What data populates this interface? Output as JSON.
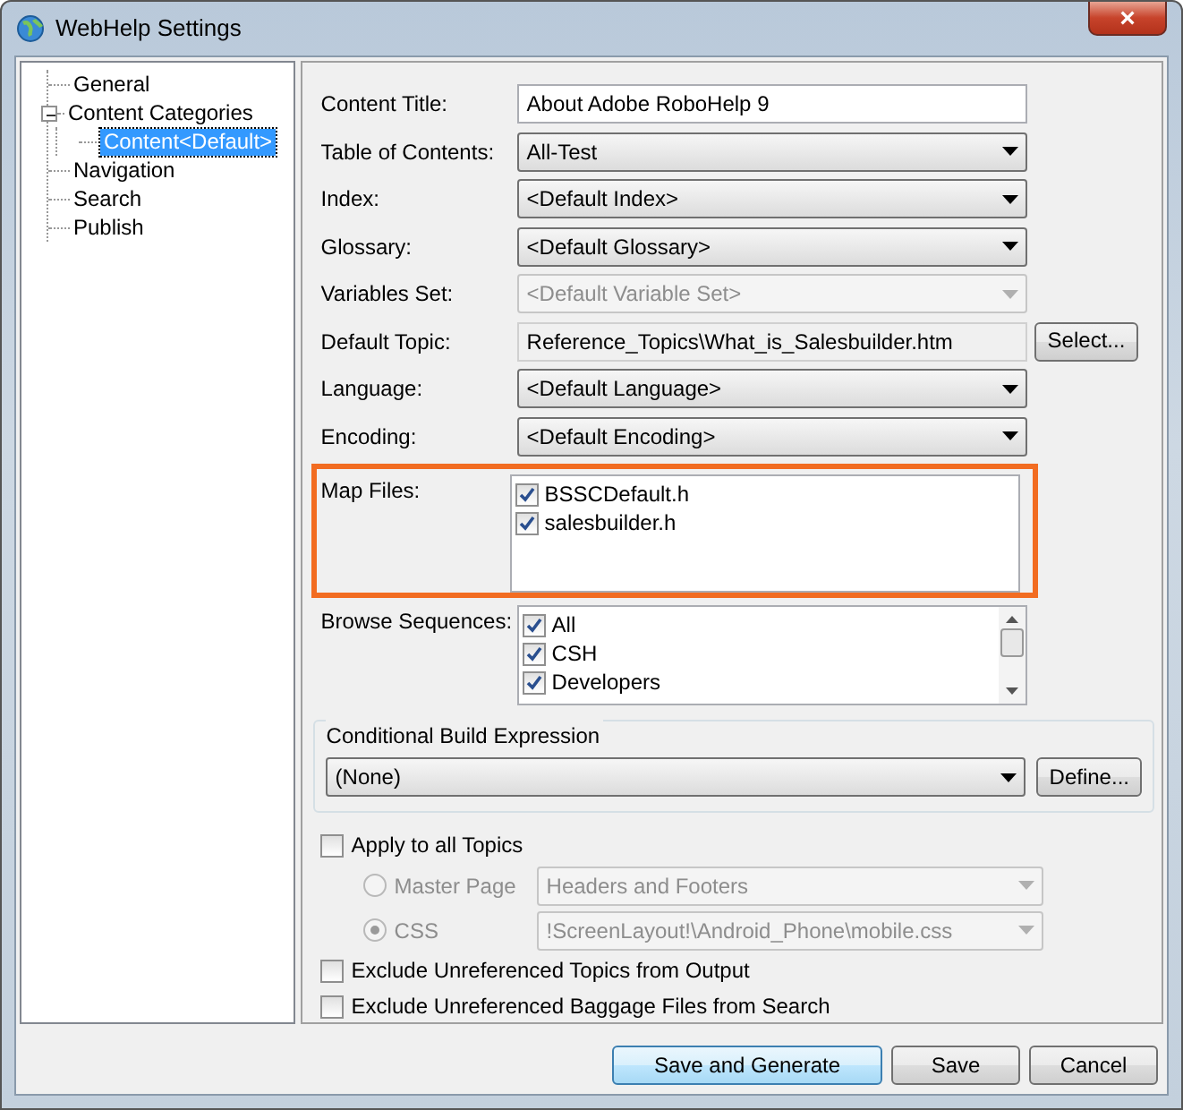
{
  "window": {
    "title": "WebHelp Settings",
    "close": "×"
  },
  "tree": [
    {
      "label": "General",
      "selected": false
    },
    {
      "label": "Content Categories",
      "selected": false,
      "expanded": true,
      "children": [
        {
          "label": "Content<Default>",
          "selected": true
        }
      ]
    },
    {
      "label": "Navigation",
      "selected": false
    },
    {
      "label": "Search",
      "selected": false
    },
    {
      "label": "Publish",
      "selected": false
    }
  ],
  "fields": [
    {
      "kind": "text",
      "label": "Content Title:",
      "value": "About Adobe RoboHelp 9"
    },
    {
      "kind": "select",
      "label": "Table of Contents:",
      "value": "All-Test",
      "disabled": false
    },
    {
      "kind": "select",
      "label": "Index:",
      "value": "<Default Index>",
      "disabled": false
    },
    {
      "kind": "select",
      "label": "Glossary:",
      "value": "<Default Glossary>",
      "disabled": false
    },
    {
      "kind": "select",
      "label": "Variables Set:",
      "value": "<Default Variable Set>",
      "disabled": true
    },
    {
      "kind": "path",
      "label": "Default Topic:",
      "value": "Reference_Topics\\What_is_Salesbuilder.htm",
      "button": "Select..."
    },
    {
      "kind": "select",
      "label": "Language:",
      "value": "<Default Language>",
      "disabled": false
    },
    {
      "kind": "select",
      "label": "Encoding:",
      "value": "<Default Encoding>",
      "disabled": false
    }
  ],
  "map_files": {
    "label": "Map Files:",
    "highlighted": true,
    "items": [
      {
        "label": "BSSCDefault.h",
        "checked": true
      },
      {
        "label": "salesbuilder.h",
        "checked": true
      }
    ]
  },
  "browse_sequences": {
    "label": "Browse Sequences:",
    "items": [
      {
        "label": "All",
        "checked": true
      },
      {
        "label": "CSH",
        "checked": true
      },
      {
        "label": "Developers",
        "checked": true
      }
    ]
  },
  "conditional_build": {
    "title": "Conditional Build Expression",
    "value": "(None)",
    "button": "Define..."
  },
  "apply_all": {
    "label": "Apply to all Topics",
    "checked": false
  },
  "layout_options": [
    {
      "label": "Master Page",
      "selected": false,
      "disabled": true,
      "value": "Headers and Footers"
    },
    {
      "label": "CSS",
      "selected": true,
      "disabled": true,
      "value": "!ScreenLayout!\\Android_Phone\\mobile.css"
    }
  ],
  "exclude_options": [
    {
      "label": "Exclude Unreferenced Topics from Output",
      "checked": false
    },
    {
      "label": "Exclude Unreferenced Baggage Files from Search",
      "checked": false
    }
  ],
  "buttons": [
    {
      "label": "Save and Generate",
      "default": true
    },
    {
      "label": "Save",
      "default": false
    },
    {
      "label": "Cancel",
      "default": false
    }
  ]
}
